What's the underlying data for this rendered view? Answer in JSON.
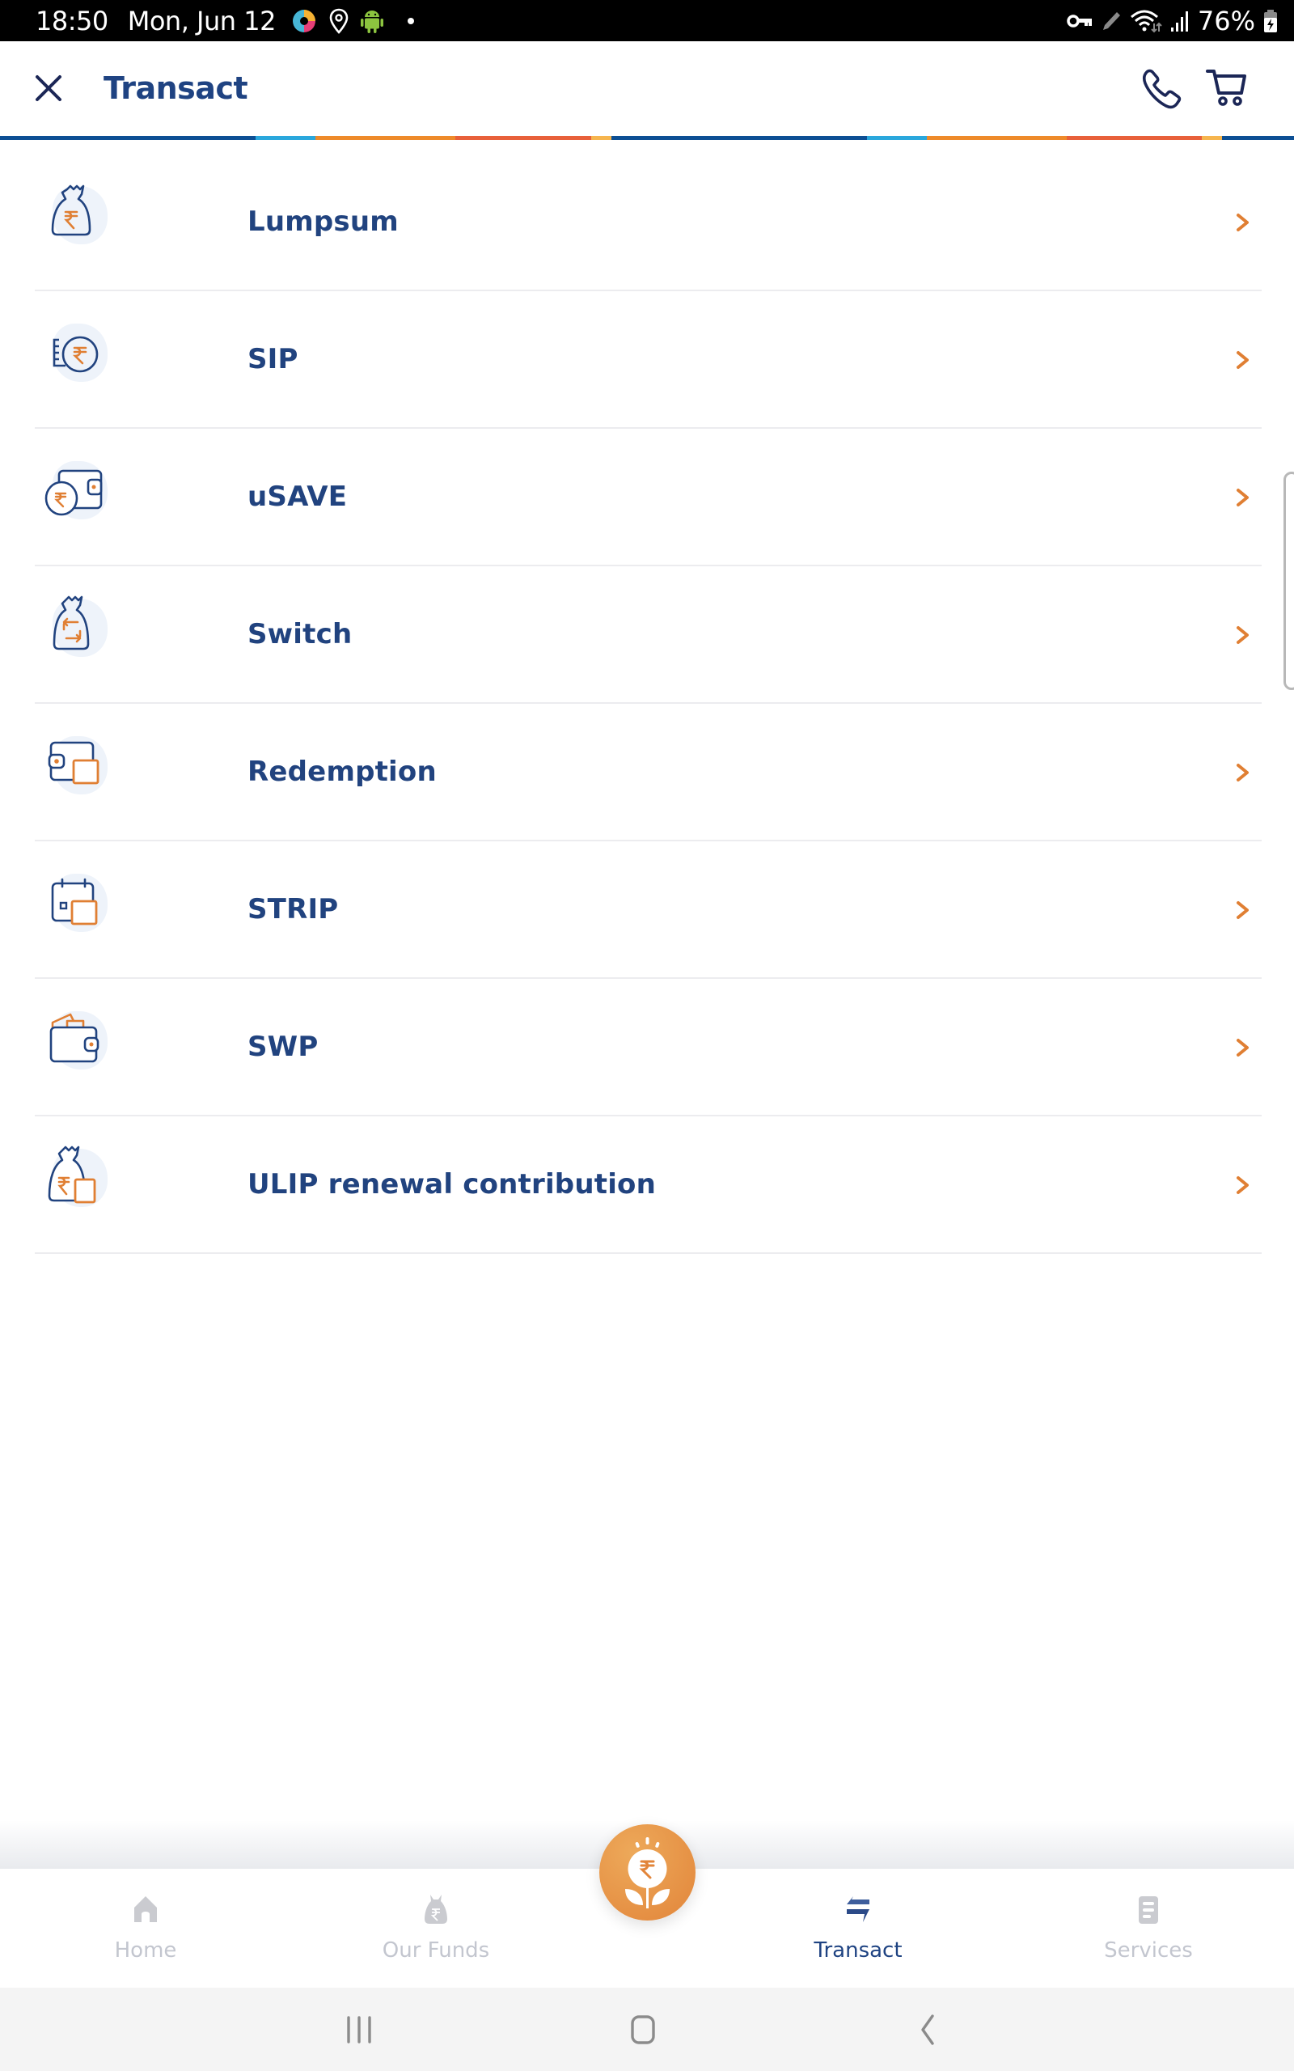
{
  "status_bar": {
    "time": "18:50",
    "date": "Mon, Jun 12",
    "left_icons": [
      "app-notification-icon",
      "location-icon",
      "android-icon",
      "dot-icon"
    ],
    "right_icons": [
      "vpn-key-icon",
      "pen-icon",
      "wifi-icon",
      "signal-icon",
      "battery-charging-icon"
    ],
    "battery": "76%"
  },
  "header": {
    "title": "Transact",
    "close_icon": "close-icon",
    "actions": [
      "phone-icon",
      "cart-icon"
    ]
  },
  "stripe_colors": [
    "#0d4f94",
    "#2aa7dc",
    "#ee8a2a",
    "#e8603a",
    "#f6b54e"
  ],
  "menu": {
    "items": [
      {
        "label": "Lumpsum",
        "icon": "money-bag-rupee-icon"
      },
      {
        "label": "SIP",
        "icon": "rupee-coins-icon"
      },
      {
        "label": "uSAVE",
        "icon": "wallet-coin-icon"
      },
      {
        "label": "Switch",
        "icon": "money-bag-switch-icon"
      },
      {
        "label": "Redemption",
        "icon": "wallet-redeem-icon"
      },
      {
        "label": "STRIP",
        "icon": "calendar-icon"
      },
      {
        "label": "SWP",
        "icon": "wallet-cards-icon"
      },
      {
        "label": "ULIP renewal contribution",
        "icon": "money-bag-document-icon"
      }
    ],
    "chevron_icon": "chevron-right-icon"
  },
  "bottom_nav": {
    "items": [
      {
        "label": "Home",
        "icon": "home-icon",
        "active": false
      },
      {
        "label": "Our Funds",
        "icon": "fund-bag-icon",
        "active": false
      },
      {
        "label": "Transact",
        "icon": "transfer-icon",
        "active": true
      },
      {
        "label": "Services",
        "icon": "services-icon",
        "active": false
      }
    ],
    "fab_icon": "rupee-plant-icon"
  },
  "system_nav": {
    "buttons": [
      "recent-apps-icon",
      "home-circle-icon",
      "back-icon"
    ]
  },
  "colors": {
    "primary": "#1f4382",
    "accent": "#e2853a",
    "inactive": "#c3c6cf",
    "divider": "#ececef"
  }
}
